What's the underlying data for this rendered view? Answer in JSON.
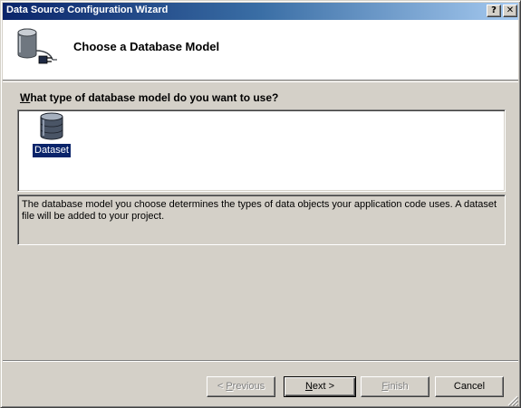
{
  "window": {
    "title": "Data Source Configuration Wizard",
    "help_button": "?",
    "close_button": "✕"
  },
  "header": {
    "title": "Choose a Database Model",
    "icon": "database-plug-icon"
  },
  "question": {
    "accel": "W",
    "rest": "hat type of database model do you want to use?"
  },
  "models": [
    {
      "label": "Dataset",
      "icon": "database-icon",
      "selected": true
    }
  ],
  "description": "The database model you choose determines the types of data objects your application code uses. A dataset file will be added to your project.",
  "buttons": {
    "previous": {
      "prefix": "< ",
      "accel": "P",
      "rest": "revious",
      "enabled": false
    },
    "next": {
      "accel": "N",
      "rest": "ext >",
      "enabled": true
    },
    "finish": {
      "accel": "F",
      "rest": "inish",
      "enabled": false
    },
    "cancel": {
      "label": "Cancel",
      "enabled": true
    }
  },
  "colors": {
    "title_bar_start": "#0a246a",
    "title_bar_end": "#a6caf0",
    "selection": "#0a246a",
    "face": "#d4d0c8"
  }
}
